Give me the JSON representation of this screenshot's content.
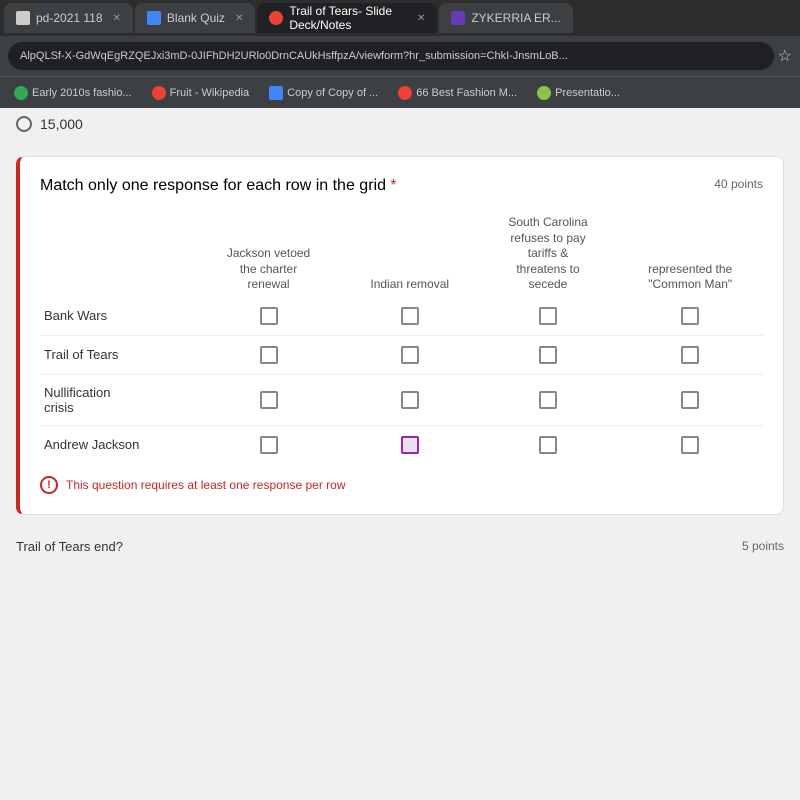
{
  "browser": {
    "tabs": [
      {
        "id": "tab1",
        "label": "pd-2021 118",
        "active": false,
        "favicon": "plain"
      },
      {
        "id": "tab2",
        "label": "Blank Quiz",
        "active": false,
        "favicon": "blue-rect"
      },
      {
        "id": "tab3",
        "label": "Trail of Tears- Slide Deck/Notes",
        "active": true,
        "favicon": "orange-circle"
      },
      {
        "id": "tab4",
        "label": "ZYKERRIA ER...",
        "active": false,
        "favicon": "purple-rect"
      }
    ],
    "address_bar": "AlpQLSf-X-GdWqEgRZQEJxi3mD-0JIFhDH2URlo0DrnCAUkHsffpzA/viewform?hr_submission=ChkI-JnsmLoB...",
    "bookmarks": [
      {
        "label": "Early 2010s fashio...",
        "favicon": "green"
      },
      {
        "label": "Fruit - Wikipedia",
        "favicon": "orange"
      },
      {
        "label": "Copy of Copy of ...",
        "favicon": "blue-rect"
      },
      {
        "label": "66 Best Fashion M...",
        "favicon": "orange"
      },
      {
        "label": "Presentatio...",
        "favicon": "avocado"
      }
    ]
  },
  "page": {
    "radio_option": "15,000",
    "quiz_card": {
      "question": "Match only one response for each row in the grid",
      "required": true,
      "points": "40 points",
      "columns": [
        "",
        "Jackson vetoed the charter renewal",
        "Indian removal",
        "South Carolina refuses to pay tariffs & threatens to secede",
        "represented the \"Common Man\""
      ],
      "rows": [
        {
          "label": "Bank Wars",
          "checked": [
            false,
            false,
            false,
            false
          ]
        },
        {
          "label": "Trail of Tears",
          "checked": [
            false,
            false,
            false,
            false
          ]
        },
        {
          "label": "Nullification crisis",
          "checked": [
            false,
            false,
            false,
            false
          ]
        },
        {
          "label": "Andrew Jackson",
          "checked": [
            false,
            true,
            false,
            false
          ]
        }
      ],
      "error_message": "This question requires at least one response per row"
    },
    "bottom_text": "Trail of Tears end?",
    "bottom_points": "5 points"
  }
}
